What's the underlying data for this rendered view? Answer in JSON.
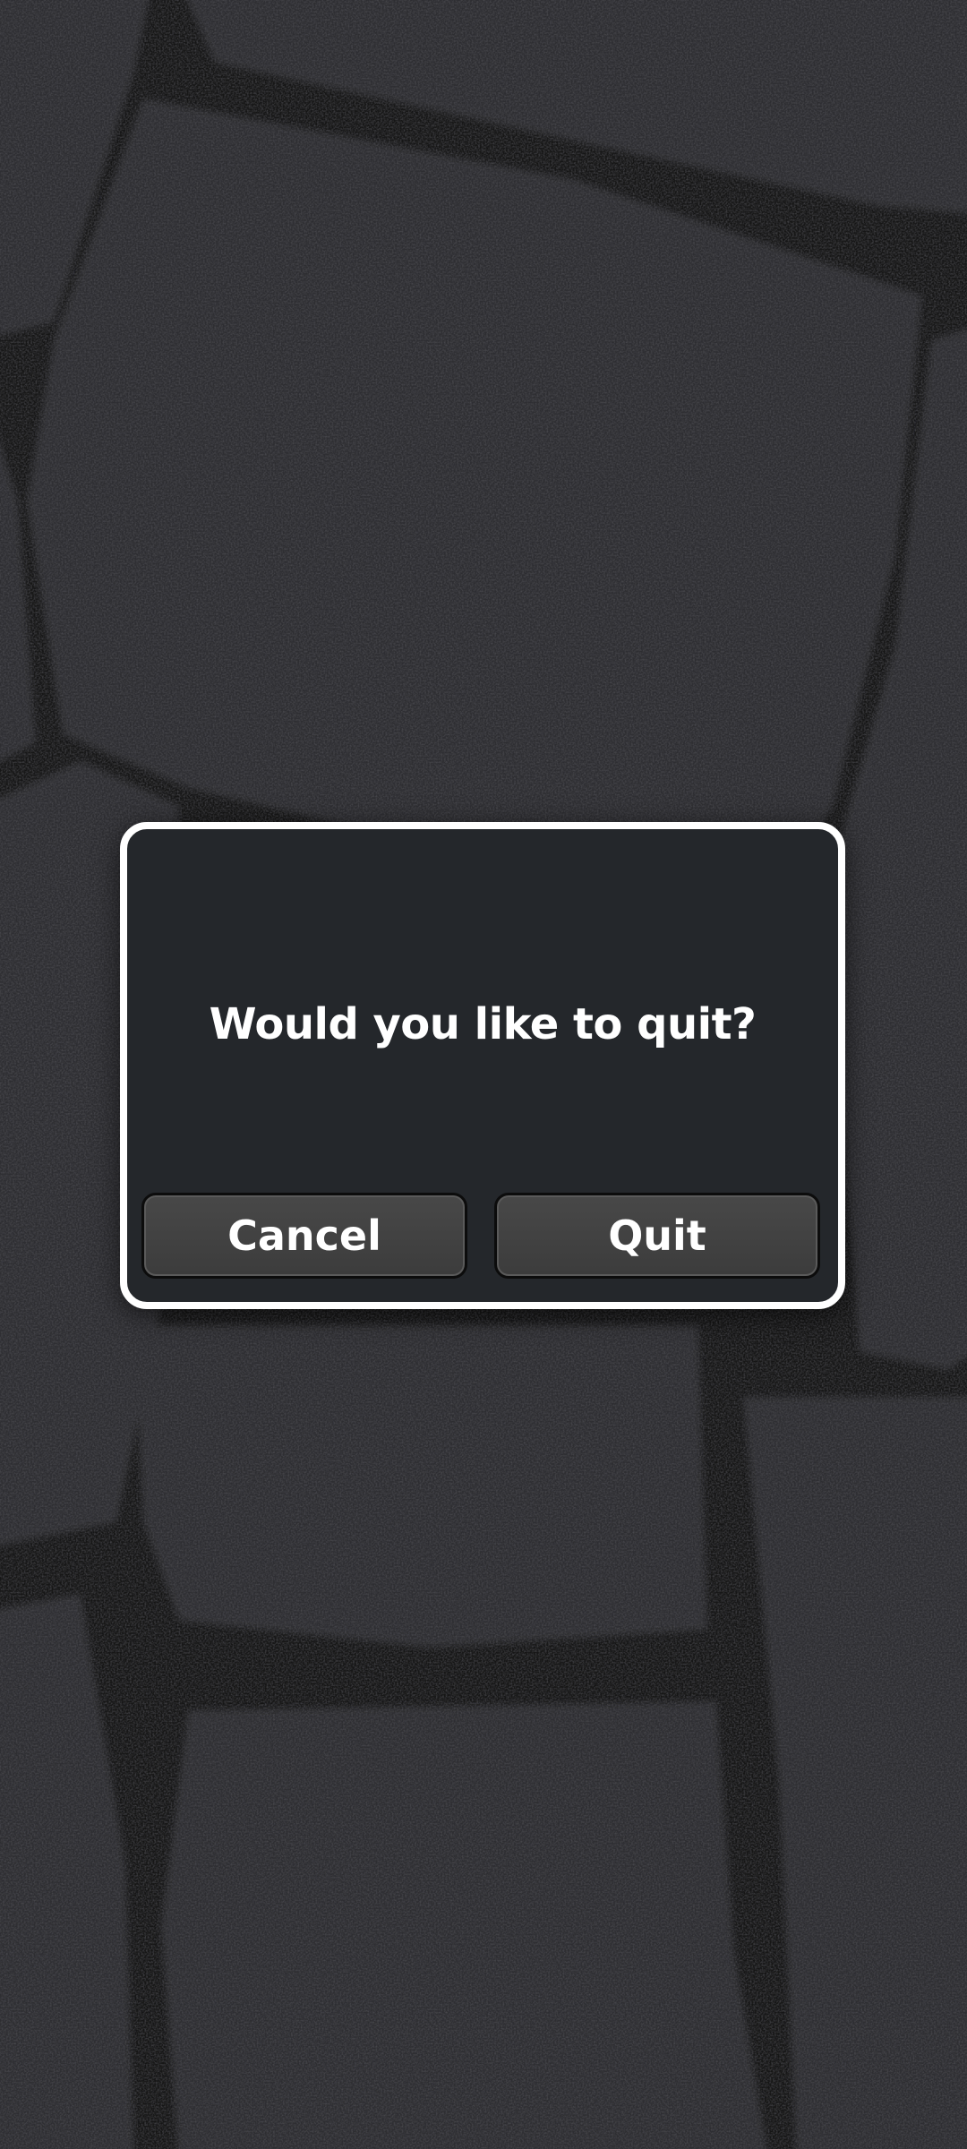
{
  "dialog": {
    "message": "Would you like to quit?",
    "cancel_label": "Cancel",
    "quit_label": "Quit"
  },
  "colors": {
    "dialog_background": "#24272b",
    "dialog_border": "#ffffff",
    "button_background": "#424242",
    "text": "#ffffff"
  }
}
